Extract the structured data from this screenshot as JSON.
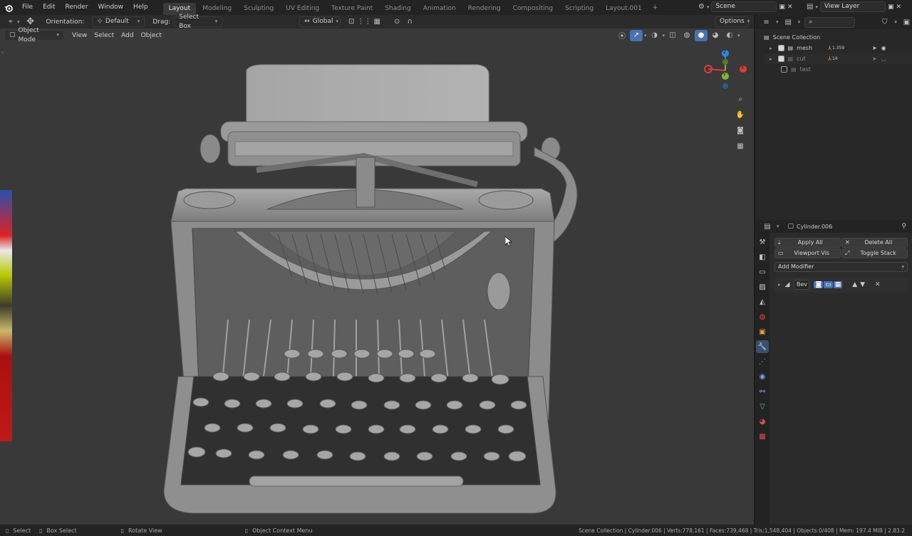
{
  "menus": [
    "File",
    "Edit",
    "Render",
    "Window",
    "Help"
  ],
  "workspace_tabs": [
    "Layout",
    "Modeling",
    "Sculpting",
    "UV Editing",
    "Texture Paint",
    "Shading",
    "Animation",
    "Rendering",
    "Compositing",
    "Scripting",
    "Layout.001"
  ],
  "active_tab": "Layout",
  "add_tab_label": "+",
  "scene": {
    "name": "Scene",
    "view_layer": "View Layer"
  },
  "toolbar": {
    "orientation_label": "Orientation:",
    "orientation_value": "Default",
    "drag_label": "Drag:",
    "drag_value": "Select Box",
    "transform_value": "Global",
    "options_label": "Options"
  },
  "viewport_header": {
    "mode": "Object Mode",
    "menus": [
      "View",
      "Select",
      "Add",
      "Object"
    ]
  },
  "gizmo": {
    "x": "X",
    "y": "Y",
    "z": "Z"
  },
  "outliner": {
    "search_placeholder": "",
    "root": "Scene Collection",
    "items": [
      {
        "name": "mesh",
        "badge": "1.359",
        "checked": true
      },
      {
        "name": "cut",
        "badge": "14",
        "checked": true
      },
      {
        "name": "test",
        "badge": "",
        "checked": false
      }
    ]
  },
  "properties": {
    "object_name": "Cylinder.006",
    "apply_all": "Apply All",
    "delete_all": "Delete All",
    "viewport_vis": "Viewport Vis",
    "toggle_stack": "Toggle Stack",
    "add_modifier": "Add Modifier",
    "modifier_name": "Bev"
  },
  "statusbar": {
    "select": "Select",
    "box_select": "Box Select",
    "rotate_view": "Rotate View",
    "context_menu": "Object Context Menu",
    "stats": "Scene Collection | Cylinder.006 | Verts:778,161 | Faces:739,468 | Tris:1,548,404 | Objects:0/408 | Mem: 197.4 MiB | 2.83.2"
  },
  "colors": {
    "accent": "#4772b3",
    "bg": "#1d1d1d",
    "viewport": "#393939",
    "axis_x": "#e03a3a",
    "axis_y": "#7ab82c",
    "axis_z": "#2f86e0"
  }
}
